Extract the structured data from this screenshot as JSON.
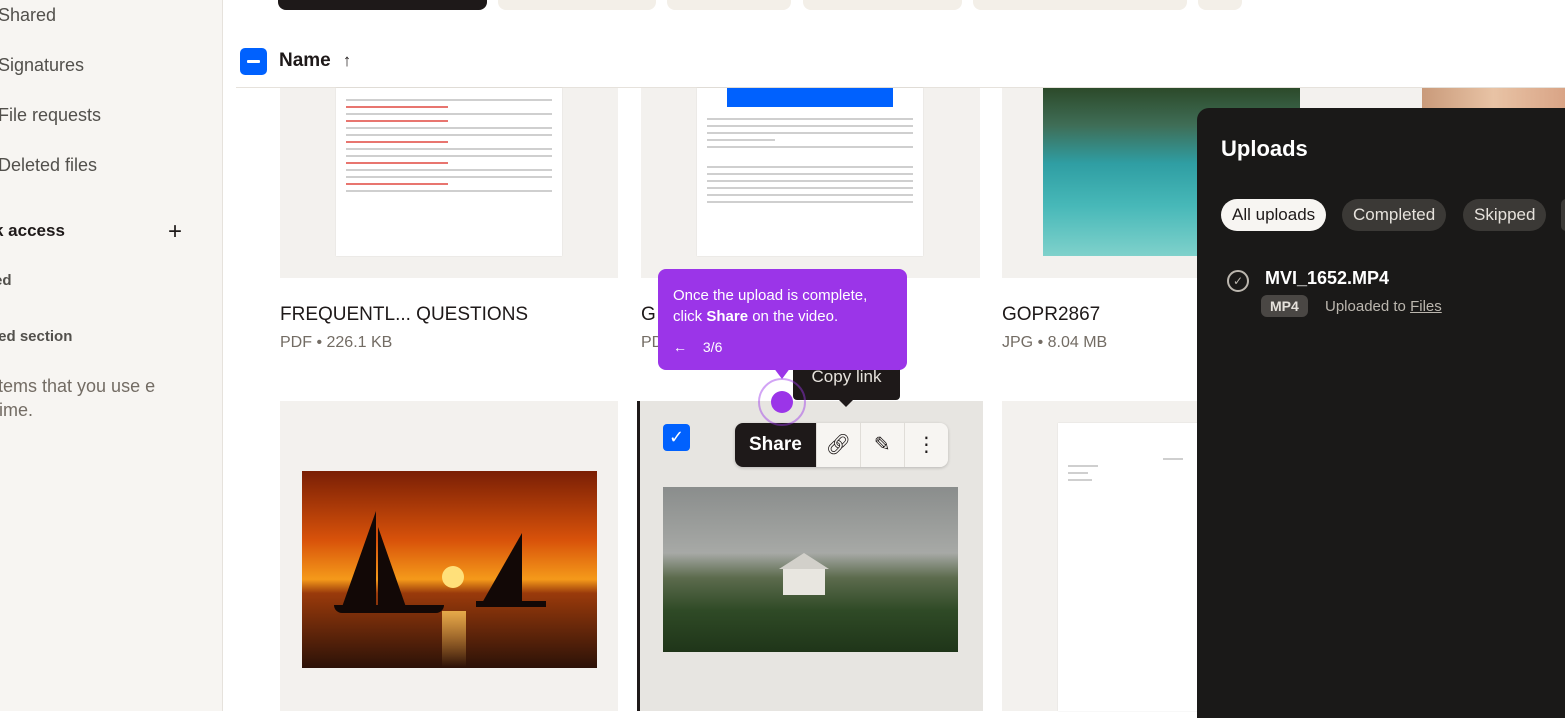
{
  "sidebar": {
    "items": [
      "Shared",
      "Signatures",
      "File requests",
      "Deleted files"
    ],
    "quick_access": "k access",
    "starred": "ed",
    "pinned_section": "led section",
    "description": "items that you use e time."
  },
  "list": {
    "column": "Name",
    "sort_icon": "arrow-up-icon"
  },
  "files": [
    {
      "name": "FREQUENTL... QUESTIONS",
      "meta": "PDF • 226.1 KB"
    },
    {
      "name": "G",
      "meta": "PD"
    },
    {
      "name": "GOPR2867",
      "meta": "JPG • 8.04 MB"
    }
  ],
  "action_bar": {
    "share": "Share"
  },
  "tooltip": {
    "copy_link": "Copy link"
  },
  "guide": {
    "text_before": "Once the upload is complete, click ",
    "text_bold": "Share",
    "text_after": " on the video.",
    "back": "←",
    "step": "3/6"
  },
  "uploads": {
    "title": "Uploads",
    "tabs": [
      "All uploads",
      "Completed",
      "Skipped"
    ],
    "file": "MVI_1652.MP4",
    "badge": "MP4",
    "uploaded_to": "Uploaded to",
    "destination": "Files"
  },
  "colors": {
    "accent": "#0061fe",
    "guide": "#9b35e8",
    "dark": "#1e1919"
  }
}
